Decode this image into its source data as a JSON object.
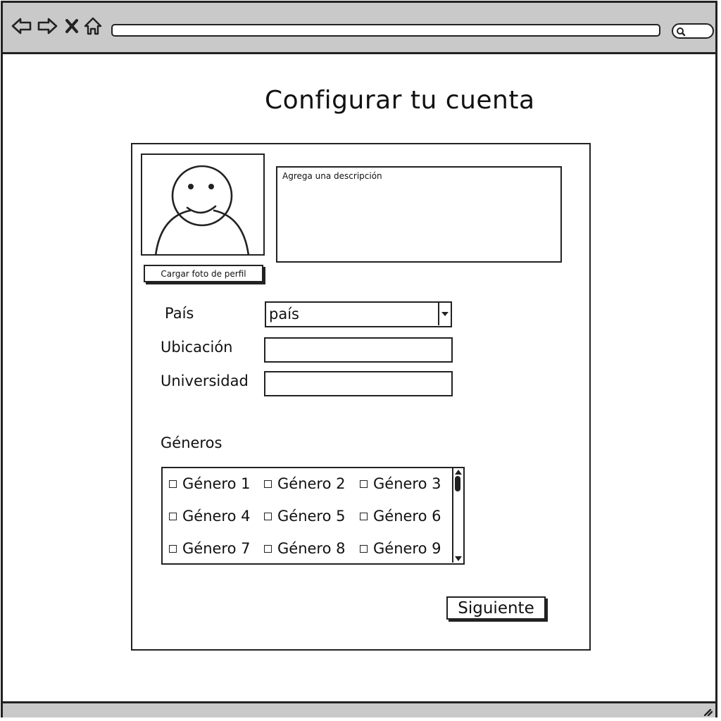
{
  "page": {
    "title": "Configurar tu cuenta"
  },
  "profile": {
    "upload_label": "Cargar foto de perfil",
    "description_placeholder": "Agrega una descripción",
    "description_value": ""
  },
  "form": {
    "country": {
      "label": "País",
      "selected": "país"
    },
    "location": {
      "label": "Ubicación",
      "value": ""
    },
    "university": {
      "label": "Universidad",
      "value": ""
    }
  },
  "genres": {
    "label": "Géneros",
    "items": [
      "Género 1",
      "Género 2",
      "Género 3",
      "Género 4",
      "Género 5",
      "Género 6",
      "Género 7",
      "Género 8",
      "Género 9"
    ]
  },
  "actions": {
    "next_label": "Siguiente"
  },
  "colors": {
    "chrome": "#c9c9c9",
    "ink": "#222222"
  }
}
